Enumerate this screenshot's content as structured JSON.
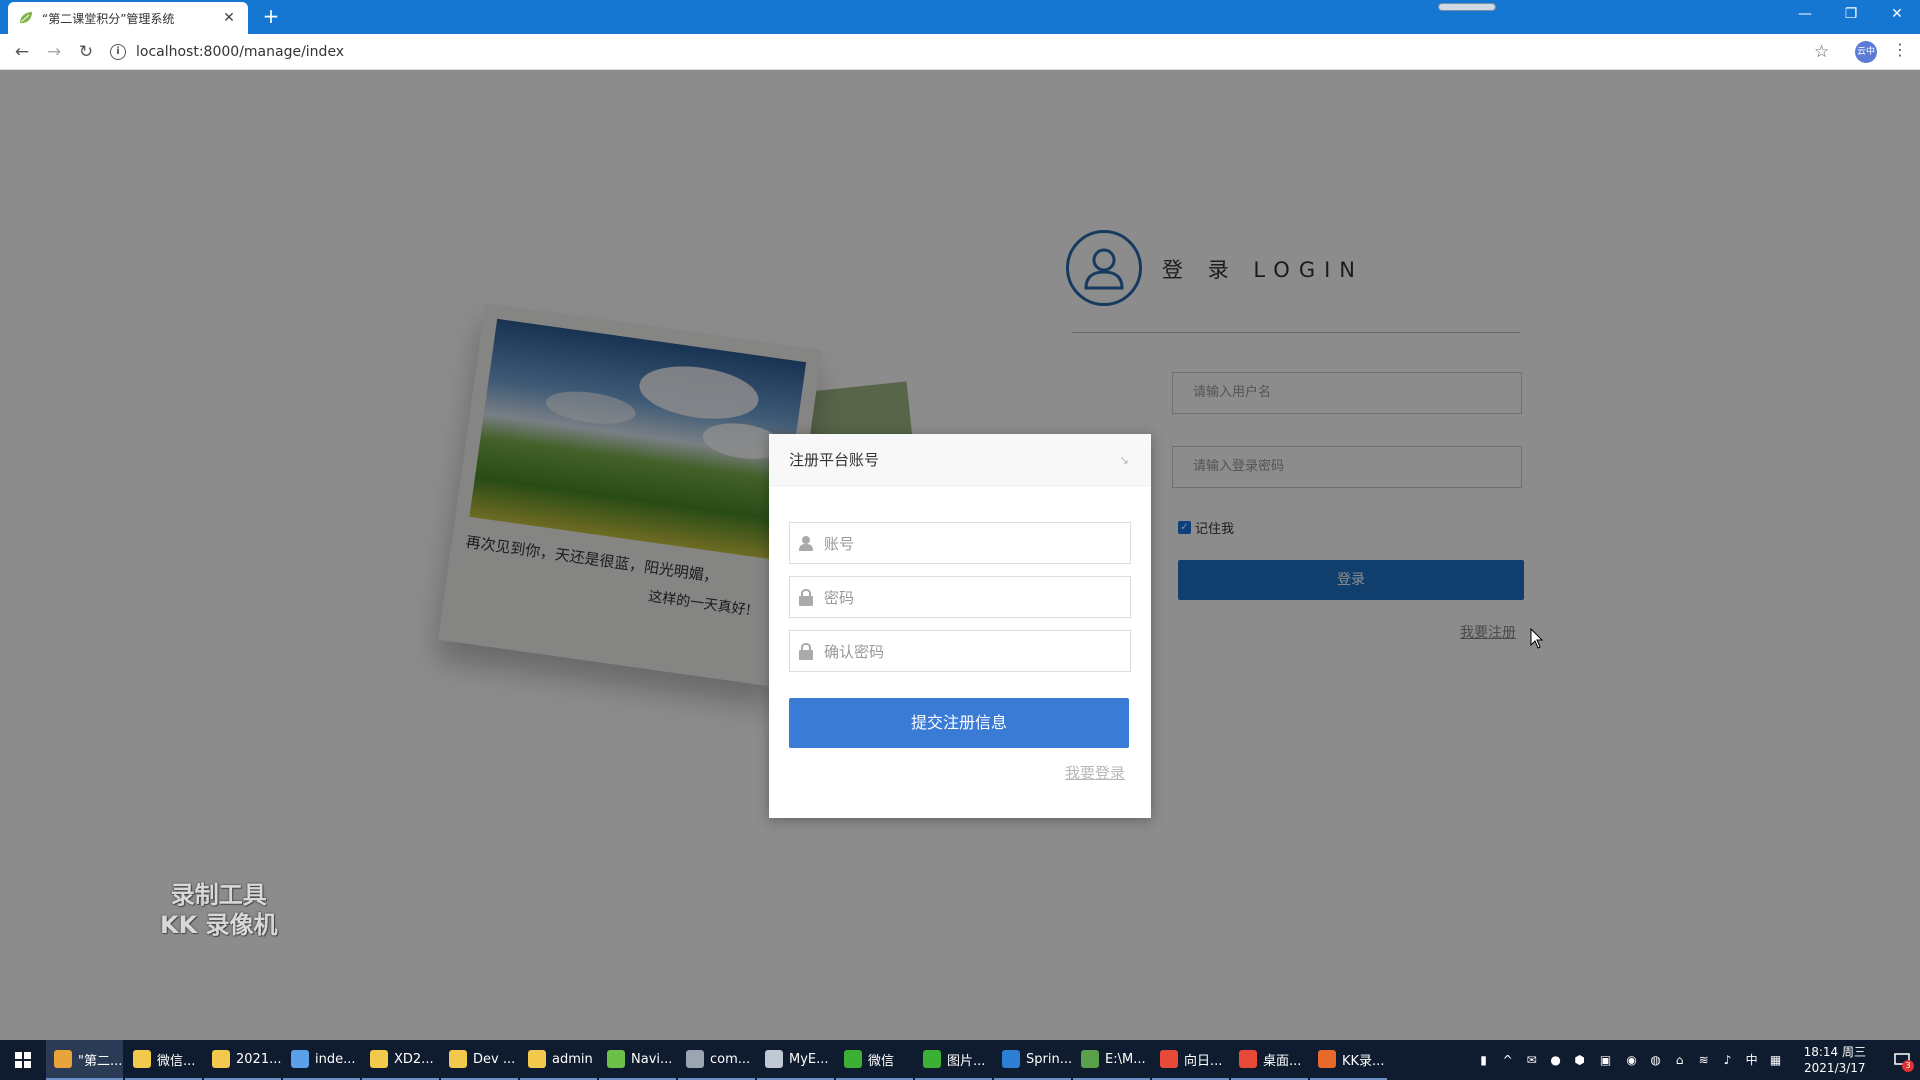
{
  "browser": {
    "tab_title": "“第二课堂积分”管理系统",
    "url": "localhost:8000/manage/index",
    "profile_label": "云中"
  },
  "login": {
    "title": "登 录 LOGIN",
    "username_placeholder": "请输入用户名",
    "password_placeholder": "请输入登录密码",
    "remember_label": "记住我",
    "remember_checked": true,
    "login_button": "登录",
    "register_link": "我要注册"
  },
  "postcard": {
    "caption_line1": "再次见到你，天还是很蓝，阳光明媚，",
    "caption_line2": "这样的一天真好!"
  },
  "modal": {
    "title": "注册平台账号",
    "account_placeholder": "账号",
    "password_placeholder": "密码",
    "confirm_placeholder": "确认密码",
    "submit_button": "提交注册信息",
    "login_link": "我要登录"
  },
  "watermark": {
    "line1": "录制工具",
    "line2": "KK 录像机"
  },
  "taskbar": {
    "tasks": [
      {
        "label": "\"第二...",
        "color": "#e8a33a",
        "active": true
      },
      {
        "label": "微信...",
        "color": "#f2c94c"
      },
      {
        "label": "2021...",
        "color": "#f2c94c"
      },
      {
        "label": "inde...",
        "color": "#5aa0e8"
      },
      {
        "label": "XD2...",
        "color": "#f2c94c"
      },
      {
        "label": "Dev ...",
        "color": "#f2c94c"
      },
      {
        "label": "admin",
        "color": "#f2c94c"
      },
      {
        "label": "Navi...",
        "color": "#6cc04a"
      },
      {
        "label": "com...",
        "color": "#9aa5b1"
      },
      {
        "label": "MyE...",
        "color": "#c0c8d4"
      },
      {
        "label": "微信",
        "color": "#3cb034"
      },
      {
        "label": "图片...",
        "color": "#3cb034"
      },
      {
        "label": "Sprin...",
        "color": "#2d7fd3"
      },
      {
        "label": "E:\\M...",
        "color": "#5aa04a"
      },
      {
        "label": "向日...",
        "color": "#e84a3a"
      },
      {
        "label": "桌面...",
        "color": "#e84a3a"
      },
      {
        "label": "KK录...",
        "color": "#e86a2a"
      }
    ],
    "ime": "中",
    "time": "18:14 周三",
    "date": "2021/3/17",
    "notification_count": "3"
  }
}
